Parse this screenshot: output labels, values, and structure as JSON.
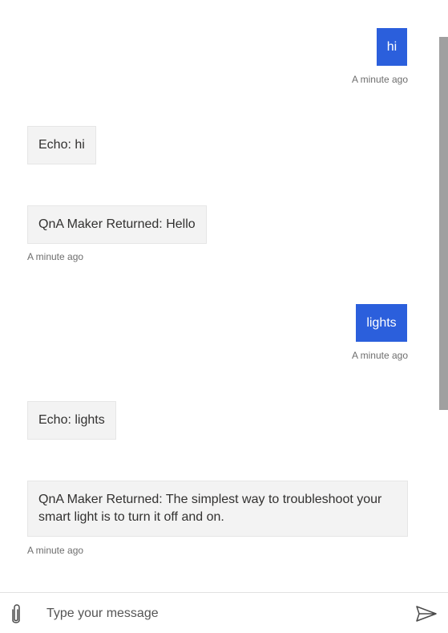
{
  "messages": [
    {
      "from": "user",
      "text": "hi",
      "timestamp": "A minute ago"
    },
    {
      "from": "bot",
      "text": "Echo: hi"
    },
    {
      "from": "bot",
      "text": "QnA Maker Returned: Hello",
      "timestamp": "A minute ago"
    },
    {
      "from": "user",
      "text": "lights",
      "timestamp": "A minute ago"
    },
    {
      "from": "bot",
      "text": "Echo: lights"
    },
    {
      "from": "bot",
      "text": "QnA Maker Returned: The simplest way to troubleshoot your smart light is to turn it off and on.",
      "timestamp": "A minute ago"
    }
  ],
  "composer": {
    "placeholder": "Type your message",
    "attach_icon": "paperclip-icon",
    "send_icon": "send-icon"
  },
  "colors": {
    "user_bubble": "#2b5fdc",
    "bot_bubble": "#f3f3f3",
    "scrollbar_thumb": "#a0a0a0"
  }
}
